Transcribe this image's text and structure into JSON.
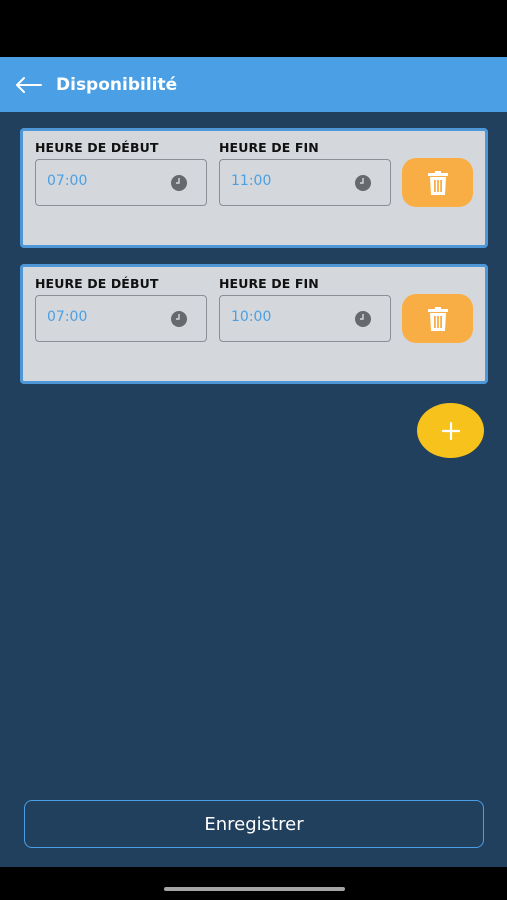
{
  "app_bar": {
    "title": "Disponibilité",
    "back_icon": "arrow-left-icon",
    "background": "#4a9fe5"
  },
  "slots": [
    {
      "start_label": "HEURE DE DÉBUT",
      "start_value": "07:00",
      "end_label": "HEURE DE FIN",
      "end_value": "11:00",
      "delete_icon": "trash-icon"
    },
    {
      "start_label": "HEURE DE DÉBUT",
      "start_value": "07:00",
      "end_label": "HEURE DE FIN",
      "end_value": "10:00",
      "delete_icon": "trash-icon"
    }
  ],
  "add_button": {
    "icon": "plus-icon",
    "color": "#f7c21b"
  },
  "save_button": {
    "label": "Enregistrer"
  },
  "colors": {
    "accent": "#4a9fe5",
    "background": "#20405d",
    "delete": "#f9ad45",
    "card": "#d4d8dc"
  }
}
